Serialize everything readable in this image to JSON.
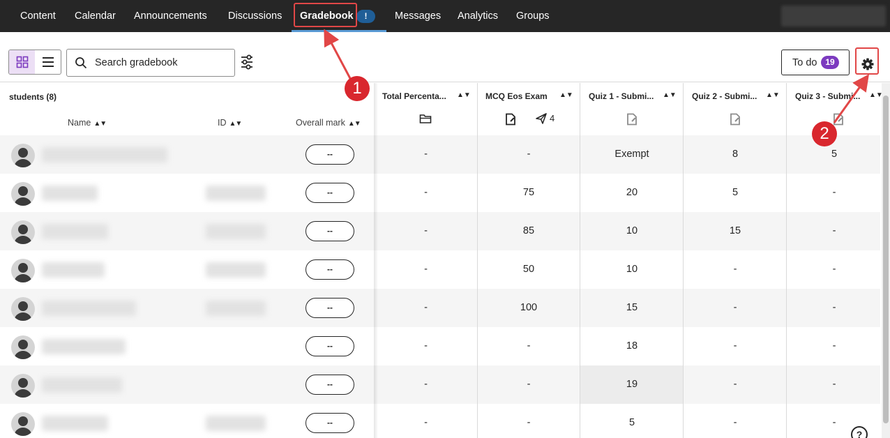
{
  "nav": {
    "items": [
      {
        "label": "Content"
      },
      {
        "label": "Calendar"
      },
      {
        "label": "Announcements"
      },
      {
        "label": "Discussions"
      },
      {
        "label": "Gradebook"
      },
      {
        "label": "Messages"
      },
      {
        "label": "Analytics"
      },
      {
        "label": "Groups"
      }
    ],
    "active": "Gradebook",
    "gradebook_badge": "!"
  },
  "toolbar": {
    "search_placeholder": "Search gradebook",
    "todo_label": "To do",
    "todo_count": "19"
  },
  "students_panel": {
    "count_label": "students (8)",
    "columns": {
      "name": "Name",
      "id": "ID",
      "overall": "Overall mark"
    },
    "overall_mark_value": "--"
  },
  "grade_columns": [
    {
      "title": "Total Percenta...",
      "icon": "folder-icon"
    },
    {
      "title": "MCQ Eos Exam",
      "icon": "document-icon",
      "extra_icon": "send-icon",
      "extra_count": "4"
    },
    {
      "title": "Quiz 1 - Submi...",
      "icon": "document-icon"
    },
    {
      "title": "Quiz 2 - Submi...",
      "icon": "document-icon"
    },
    {
      "title": "Quiz 3 - Submi...",
      "icon": "document-icon"
    }
  ],
  "rows": [
    [
      "-",
      "-",
      "Exempt",
      "8",
      "5"
    ],
    [
      "-",
      "75",
      "20",
      "5",
      "-"
    ],
    [
      "-",
      "85",
      "10",
      "15",
      "-"
    ],
    [
      "-",
      "50",
      "10",
      "-",
      "-"
    ],
    [
      "-",
      "100",
      "15",
      "-",
      "-"
    ],
    [
      "-",
      "-",
      "18",
      "-",
      "-"
    ],
    [
      "-",
      "-",
      "19",
      "-",
      "-"
    ],
    [
      "-",
      "-",
      "5",
      "-",
      "-"
    ]
  ],
  "callouts": [
    "1",
    "2"
  ],
  "help_label": "?",
  "colors": {
    "nav_bg": "#262626",
    "accent_purple": "#7c3abf",
    "callout_red": "#d9272e",
    "active_underline": "#5a9bd5"
  }
}
